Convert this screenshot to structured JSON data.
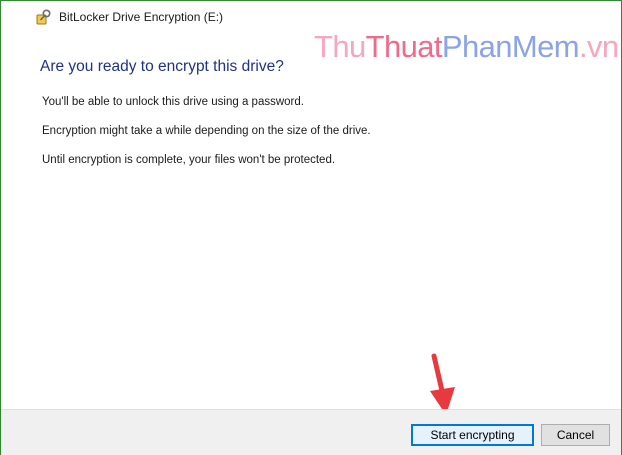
{
  "window": {
    "title": "BitLocker Drive Encryption (E:)",
    "icon": "bitlocker-key-icon",
    "accent_border": "#2f8a2f"
  },
  "watermark": {
    "part1": "Thu",
    "part2": "Thuat",
    "part3": "PhanMem",
    "part4": ".vn"
  },
  "dialog": {
    "heading": "Are you ready to encrypt this drive?",
    "paragraphs": [
      "You'll be able to unlock this drive using a password.",
      "Encryption might take a while depending on the size of the drive.",
      "Until encryption is complete, your files won't be protected."
    ]
  },
  "annotation": {
    "icon": "red-arrow-down-icon",
    "color": "#e8393f"
  },
  "footer": {
    "primary_label": "Start encrypting",
    "secondary_label": "Cancel"
  }
}
